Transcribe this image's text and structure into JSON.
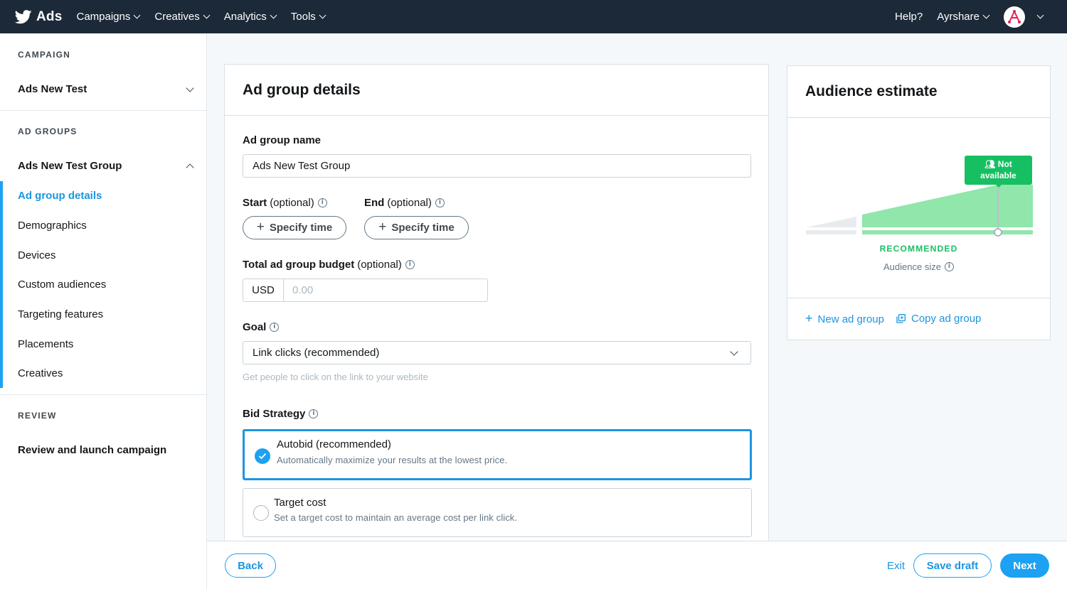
{
  "topbar": {
    "brand": "Ads",
    "nav": [
      {
        "label": "Campaigns"
      },
      {
        "label": "Creatives"
      },
      {
        "label": "Analytics"
      },
      {
        "label": "Tools"
      }
    ],
    "help": "Help?",
    "account": "Ayrshare",
    "bg_color": "#1c2938"
  },
  "sidebar": {
    "campaign_section": "CAMPAIGN",
    "campaign_name": "Ads New Test",
    "adgroups_section": "AD GROUPS",
    "adgroup_name": "Ads New Test Group",
    "items": [
      {
        "label": "Ad group details",
        "active": true
      },
      {
        "label": "Demographics"
      },
      {
        "label": "Devices"
      },
      {
        "label": "Custom audiences"
      },
      {
        "label": "Targeting features"
      },
      {
        "label": "Placements"
      },
      {
        "label": "Creatives"
      }
    ],
    "review_section": "REVIEW",
    "review_item": "Review and launch campaign"
  },
  "main": {
    "title": "Ad group details",
    "name_label": "Ad group name",
    "name_value": "Ads New Test Group",
    "start_label": "Start",
    "end_label": "End",
    "optional": "(optional)",
    "specify_time": "Specify time",
    "budget_label": "Total ad group budget",
    "currency": "USD",
    "budget_placeholder": "0.00",
    "goal_label": "Goal",
    "goal_value": "Link clicks (recommended)",
    "goal_help": "Get people to click on the link to your website",
    "bid_label": "Bid Strategy",
    "bid_options": [
      {
        "title": "Autobid (recommended)",
        "desc": "Automatically maximize your results at the lowest price.",
        "selected": true
      },
      {
        "title": "Target cost",
        "desc": "Set a target cost to maintain an average cost per link click.",
        "selected": false
      }
    ]
  },
  "audience": {
    "title": "Audience estimate",
    "tag_line1": "Not",
    "tag_line2": "available",
    "recommended": "RECOMMENDED",
    "size_label": "Audience size",
    "new_group": "New ad group",
    "copy_group": "Copy ad group",
    "accent": "#17bf63"
  },
  "footer": {
    "back": "Back",
    "exit": "Exit",
    "save_draft": "Save draft",
    "next": "Next",
    "accent": "#1da1f2"
  }
}
